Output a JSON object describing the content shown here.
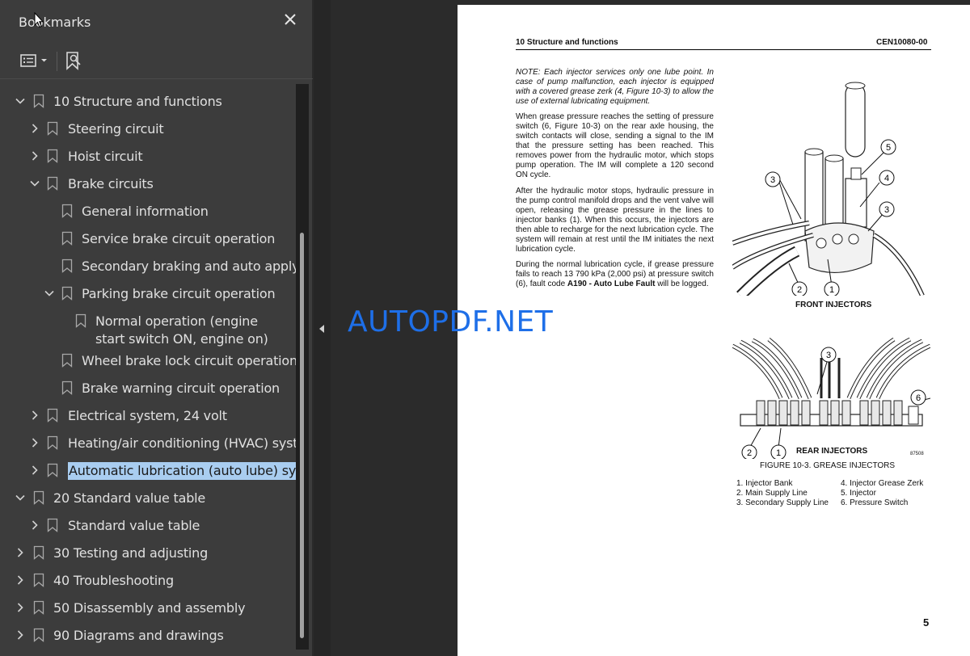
{
  "sidebar": {
    "title": "Bookmarks",
    "close_icon": "close-icon",
    "toolbar": {
      "options_icon": "list-options-icon",
      "bookmark_icon": "bookmark-search-icon"
    },
    "items": [
      {
        "label": "10 Structure and functions",
        "level": 0,
        "state": "expanded"
      },
      {
        "label": "Steering circuit",
        "level": 1,
        "state": "collapsed"
      },
      {
        "label": "Hoist circuit",
        "level": 1,
        "state": "collapsed"
      },
      {
        "label": "Brake circuits",
        "level": 1,
        "state": "expanded"
      },
      {
        "label": "General information",
        "level": 2,
        "state": "leaf"
      },
      {
        "label": "Service brake circuit operation",
        "level": 2,
        "state": "leaf"
      },
      {
        "label": "Secondary braking and auto apply",
        "level": 2,
        "state": "leaf"
      },
      {
        "label": "Parking brake circuit operation",
        "level": 2,
        "state": "expanded"
      },
      {
        "label": "Normal operation (engine start switch ON, engine on)",
        "level": 3,
        "state": "leaf"
      },
      {
        "label": "Wheel brake lock circuit operation",
        "level": 2,
        "state": "leaf"
      },
      {
        "label": "Brake warning circuit operation",
        "level": 2,
        "state": "leaf"
      },
      {
        "label": "Electrical system, 24 volt",
        "level": 1,
        "state": "collapsed"
      },
      {
        "label": "Heating/air conditioning (HVAC) system",
        "level": 1,
        "state": "collapsed"
      },
      {
        "label": "Automatic lubrication (auto lube) system",
        "level": 1,
        "state": "collapsed",
        "selected": true
      },
      {
        "label": "20 Standard value table",
        "level": 0,
        "state": "expanded"
      },
      {
        "label": "Standard value table",
        "level": 1,
        "state": "collapsed"
      },
      {
        "label": "30 Testing and adjusting",
        "level": 0,
        "state": "collapsed"
      },
      {
        "label": "40 Troubleshooting",
        "level": 0,
        "state": "collapsed"
      },
      {
        "label": "50 Disassembly and assembly",
        "level": 0,
        "state": "collapsed"
      },
      {
        "label": "90 Diagrams and drawings",
        "level": 0,
        "state": "collapsed"
      }
    ]
  },
  "document": {
    "header_left": "10 Structure and functions",
    "header_right": "CEN10080-00",
    "note": "NOTE: Each injector services only one lube point. In case of pump malfunction, each injector is equipped with a covered grease zerk (4, Figure 10-3) to allow the use of external lubricating equipment.",
    "para1": "When grease pressure reaches the setting of pressure switch (6, Figure 10-3) on the rear axle housing, the switch contacts will close, sending a signal to the IM that the pressure setting has been reached. This removes power from the hydraulic motor, which stops pump operation. The IM will complete a 120 second ON cycle.",
    "para2": "After the hydraulic motor stops, hydraulic pressure in the pump control manifold drops and the vent valve will open, releasing the grease pressure in the lines to injector banks (1). When this occurs, the injectors are then able to recharge for the next lubrication cycle. The system will remain at rest until the IM initiates the next lubrication cycle.",
    "para3_before": "During the normal lubrication cycle, if grease pressure fails to reach 13 790 kPa (2,000 psi) at pressure switch (6), fault code ",
    "para3_bold": "A190 - Auto Lube Fault",
    "para3_after": " will be logged.",
    "front_caption": "FRONT INJECTORS",
    "rear_caption": "REAR INJECTORS",
    "figure_number": "87508",
    "figure_caption": "FIGURE 10-3. GREASE INJECTORS",
    "callouts_front": [
      "1",
      "2",
      "3",
      "3",
      "4",
      "5"
    ],
    "callouts_rear": [
      "1",
      "2",
      "3",
      "6"
    ],
    "legend_left": [
      "1. Injector Bank",
      "2. Main Supply Line",
      "3. Secondary Supply Line"
    ],
    "legend_right": [
      "4. Injector Grease Zerk",
      "5. Injector",
      "6. Pressure Switch"
    ],
    "page_number": "5"
  },
  "watermark": "AUTOPDF.NET"
}
